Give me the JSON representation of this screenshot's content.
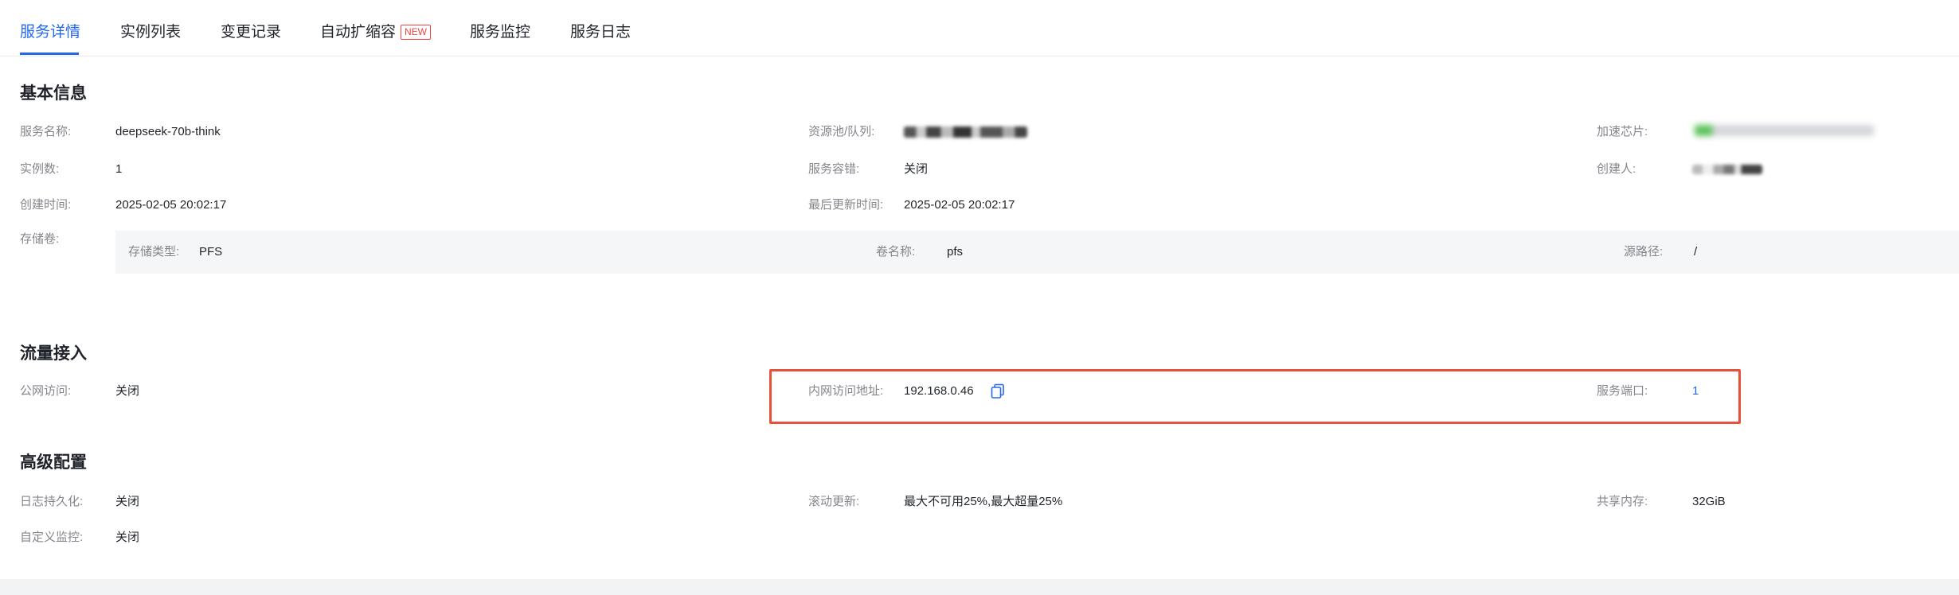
{
  "tabs": [
    {
      "label": "服务详情",
      "active": true
    },
    {
      "label": "实例列表"
    },
    {
      "label": "变更记录"
    },
    {
      "label": "自动扩缩容",
      "badge": "NEW"
    },
    {
      "label": "服务监控"
    },
    {
      "label": "服务日志"
    }
  ],
  "basic": {
    "title": "基本信息",
    "service_name_label": "服务名称:",
    "service_name": "deepseek-70b-think",
    "resource_pool_label": "资源池/队列:",
    "accel_chip_label": "加速芯片:",
    "instances_label": "实例数:",
    "instances": "1",
    "fault_tolerance_label": "服务容错:",
    "fault_tolerance": "关闭",
    "creator_label": "创建人:",
    "created_label": "创建时间:",
    "created": "2025-02-05 20:02:17",
    "updated_label": "最后更新时间:",
    "updated": "2025-02-05 20:02:17",
    "volume_label": "存储卷:",
    "storage_type_label": "存储类型:",
    "storage_type": "PFS",
    "volume_name_label": "卷名称:",
    "volume_name": "pfs",
    "source_path_label": "源路径:",
    "source_path": "/"
  },
  "traffic": {
    "title": "流量接入",
    "public_label": "公网访问:",
    "public_value": "关闭",
    "intranet_label": "内网访问地址:",
    "intranet_value": "192.168.0.46",
    "port_label": "服务端口:",
    "port_value": "1"
  },
  "advanced": {
    "title": "高级配置",
    "log_persist_label": "日志持久化:",
    "log_persist_value": "关闭",
    "rolling_label": "滚动更新:",
    "rolling_value": "最大不可用25%,最大超量25%",
    "shm_label": "共享内存:",
    "shm_value": "32GiB",
    "monitor_label": "自定义监控:",
    "monitor_value": "关闭"
  },
  "colors": {
    "accent": "#2468f2",
    "highlight_border": "#e8503a",
    "label": "#84868c",
    "text": "#1f2329"
  },
  "icons": {
    "copy": "copy-icon"
  }
}
